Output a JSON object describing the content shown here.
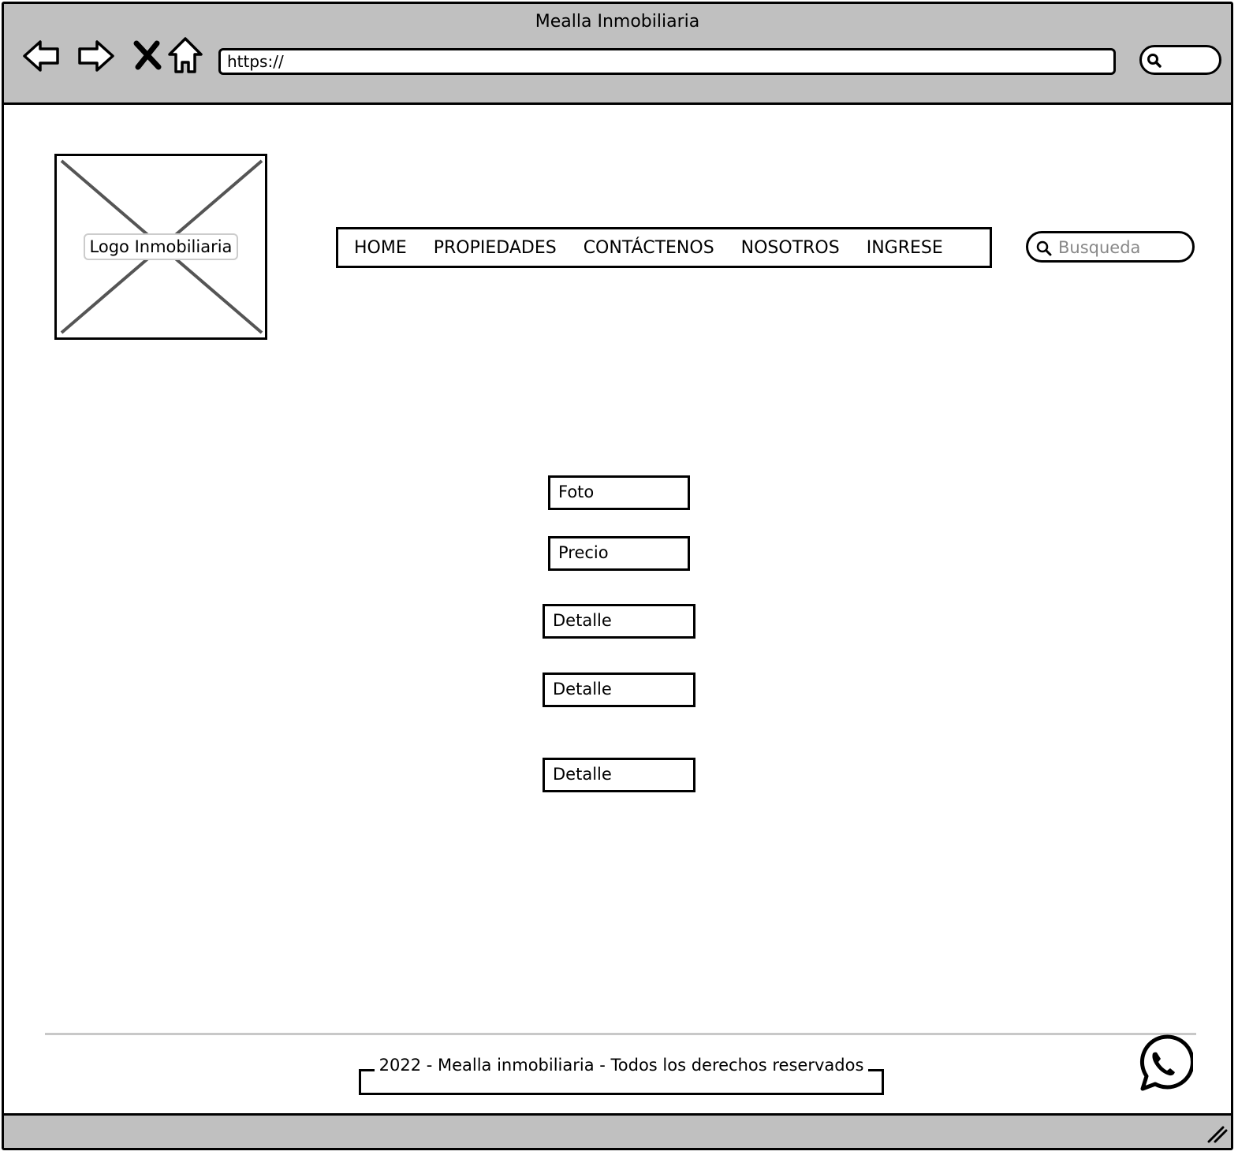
{
  "browser": {
    "title": "Mealla Inmobiliaria",
    "url": "https://",
    "icons": [
      "back-icon",
      "forward-icon",
      "close-icon",
      "home-icon",
      "search-icon"
    ]
  },
  "header": {
    "logo_label": "Logo Inmobiliaria",
    "menu": [
      {
        "label": "HOME"
      },
      {
        "label": "PROPIEDADES"
      },
      {
        "label": "CONTÁCTENOS"
      },
      {
        "label": "NOSOTROS"
      },
      {
        "label": "INGRESE"
      }
    ],
    "search": {
      "placeholder": "Busqueda",
      "value": ""
    }
  },
  "property": {
    "photo_label": "Foto",
    "price_label": "Precio",
    "details": [
      "Detalle",
      "Detalle",
      "Detalle"
    ]
  },
  "footer": {
    "copyright": "2022 - Mealla inmobiliaria - Todos los derechos reservados",
    "social_icon": "whatsapp-icon"
  },
  "colors": {
    "chrome_bg": "#c0c0c0",
    "border": "#000000",
    "placeholder_image_cross": "#555555",
    "divider": "#c8c8c8"
  }
}
